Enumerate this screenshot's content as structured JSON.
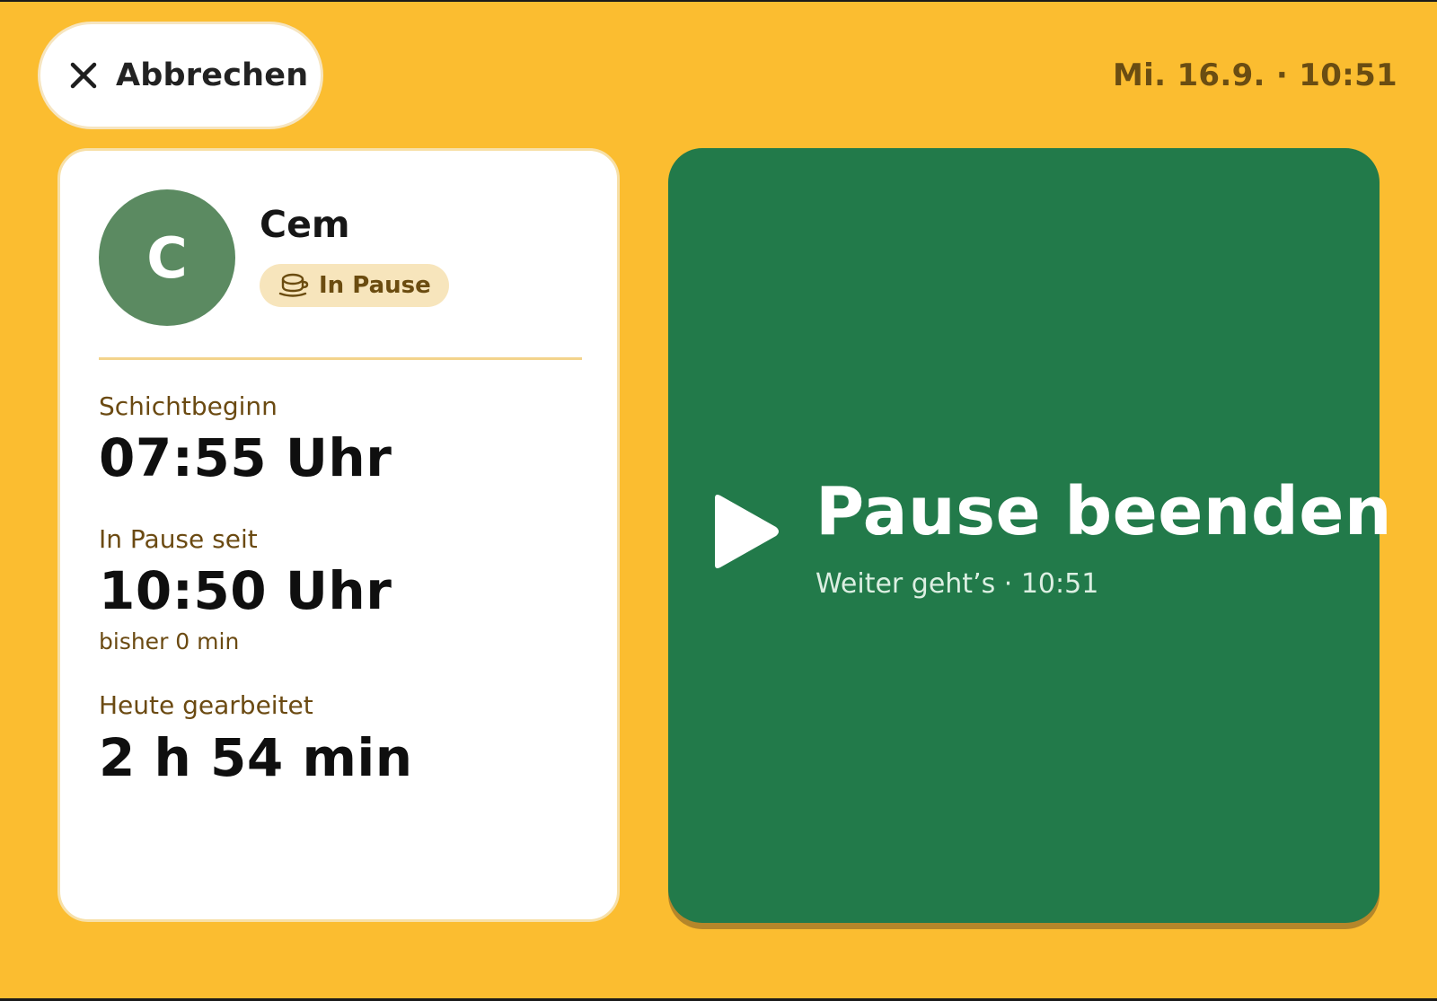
{
  "header": {
    "cancel_label": "Abbrechen",
    "datetime": "Mi. 16.9. · 10:51"
  },
  "user": {
    "initial": "C",
    "name": "Cem",
    "status": "In Pause"
  },
  "stats": {
    "shift_start_label": "Schichtbeginn",
    "shift_start_value": "07:55 Uhr",
    "pause_since_label": "In Pause seit",
    "pause_since_value": "10:50 Uhr",
    "pause_duration": "bisher 0 min",
    "worked_today_label": "Heute gearbeitet",
    "worked_today_value": "2 h 54 min"
  },
  "action": {
    "title": "Pause beenden",
    "subtitle": "Weiter geht’s · 10:51"
  },
  "colors": {
    "background": "#fbbd30",
    "action_green": "#227a4a",
    "avatar_green": "#5b8a61",
    "badge_bg": "#f7e5bc",
    "label_brown": "#6b4a12"
  },
  "icons": {
    "cancel": "close-icon",
    "status": "coffee-cup-icon",
    "action": "play-icon"
  }
}
